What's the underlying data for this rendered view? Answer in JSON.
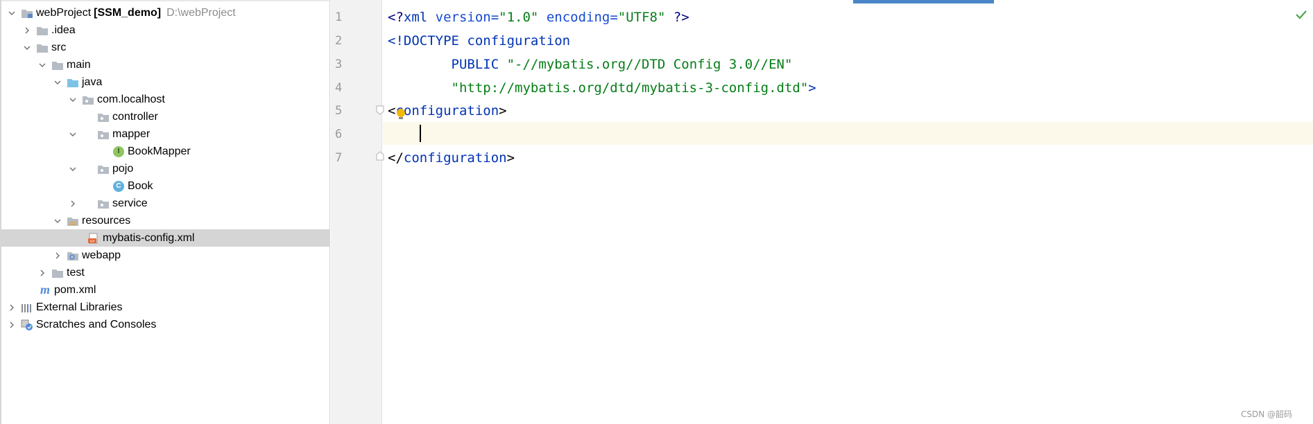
{
  "project_tree": {
    "root": {
      "name": "webProject",
      "module": "[SSM_demo]",
      "path": "D:\\webProject"
    },
    "items": [
      {
        "label": ".idea"
      },
      {
        "label": "src"
      },
      {
        "label": "main"
      },
      {
        "label": "java"
      },
      {
        "label": "com.localhost"
      },
      {
        "label": "controller"
      },
      {
        "label": "mapper"
      },
      {
        "label": "BookMapper",
        "badge": "I"
      },
      {
        "label": "pojo"
      },
      {
        "label": "Book",
        "badge": "C"
      },
      {
        "label": "service"
      },
      {
        "label": "resources"
      },
      {
        "label": "mybatis-config.xml"
      },
      {
        "label": "webapp"
      },
      {
        "label": "test"
      },
      {
        "label": "pom.xml",
        "badge": "m"
      },
      {
        "label": "External Libraries"
      },
      {
        "label": "Scratches and Consoles"
      }
    ],
    "selected": "mybatis-config.xml"
  },
  "editor": {
    "line_numbers": [
      "1",
      "2",
      "3",
      "4",
      "5",
      "6",
      "7"
    ],
    "lines": [
      {
        "p1": "<?",
        "p2": "xml",
        "p3": " version=",
        "p4": "\"1.0\"",
        "p5": " encoding=",
        "p6": "\"UTF8\"",
        "p7": " ?>"
      },
      {
        "p1": "<!",
        "p2": "DOCTYPE",
        "p3": " configuration"
      },
      {
        "p1": "        PUBLIC ",
        "p2": "\"-//mybatis.org//DTD Config 3.0//EN\""
      },
      {
        "p1": "        ",
        "p2": "\"http://mybatis.org/dtd/mybatis-3-config.dtd\"",
        "p3": ">"
      },
      {
        "p1": "<",
        "p2": "configuration",
        "p3": ">"
      },
      {
        "p1": ""
      },
      {
        "p1": "</",
        "p2": "configuration",
        "p3": ">"
      }
    ],
    "current_line": 6
  },
  "status": {
    "inspection": "check-icon"
  },
  "watermark": "CSDN @韶码",
  "colors": {
    "selection_bg": "#d5d5d5",
    "current_line_bg": "#fcf8ea",
    "tag_blue": "#0033b3",
    "string_green": "#067d17",
    "tab_indicator": "#4a86c8"
  }
}
